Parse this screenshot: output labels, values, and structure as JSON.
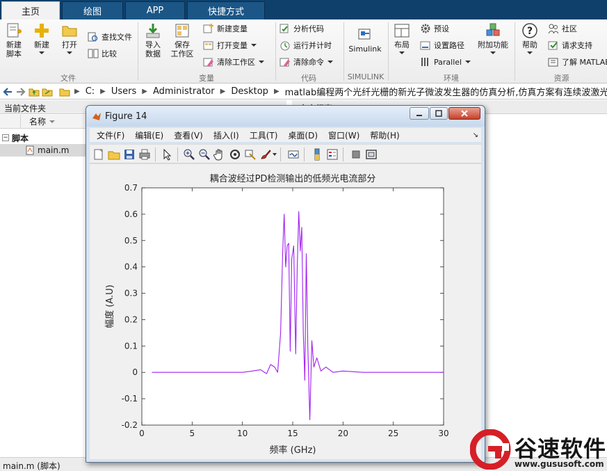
{
  "tabs": [
    {
      "label": "主页",
      "active": true
    },
    {
      "label": "绘图",
      "active": false
    },
    {
      "label": "APP",
      "active": false
    },
    {
      "label": "快捷方式",
      "active": false
    }
  ],
  "ribbon": {
    "file": {
      "new_script": "新建\n脚本",
      "new": "新建",
      "open": "打开",
      "find_files": "查找文件",
      "compare": "比较",
      "group": "文件"
    },
    "variable": {
      "import_data": "导入\n数据",
      "save_workspace": "保存\n工作区",
      "new_variable": "新建变量",
      "open_variable": "打开变量",
      "clear_workspace": "清除工作区",
      "group": "变量"
    },
    "code": {
      "analyze_code": "分析代码",
      "run_and_time": "运行并计时",
      "clear_commands": "清除命令",
      "group": "代码"
    },
    "simulink": {
      "label": "Simulink",
      "group": "SIMULINK"
    },
    "environment": {
      "layout": "布局",
      "preferences": "预设",
      "set_path": "设置路径",
      "parallel": "Parallel",
      "addons": "附加功能",
      "group": "环境"
    },
    "resources": {
      "help": "帮助",
      "community": "社区",
      "request_support": "请求支持",
      "learn_matlab": "了解 MATLAB",
      "group": "资源"
    }
  },
  "address": {
    "crumbs": [
      "C:",
      "Users",
      "Administrator",
      "Desktop",
      "matlab编程两个光纤光栅的新光子微波发生器的仿真分析,仿真方案有连续波激光器,分光器,"
    ]
  },
  "left_panel": {
    "title": "当前文件夹",
    "column_name": "名称",
    "folder": "脚本",
    "file": "main.m",
    "status": "main.m  (脚本)"
  },
  "command_window": {
    "title": "命令行窗口"
  },
  "figure": {
    "title": "Figure 14",
    "menus": [
      "文件(F)",
      "编辑(E)",
      "查看(V)",
      "插入(I)",
      "工具(T)",
      "桌面(D)",
      "窗口(W)",
      "帮助(H)"
    ]
  },
  "chart_data": {
    "type": "line",
    "title": "耦合波经过PD检测输出的低频光电流部分",
    "xlabel": "频率 (GHz)",
    "ylabel": "幅度 (A.U)",
    "xlim": [
      0,
      30
    ],
    "ylim": [
      -0.2,
      0.7
    ],
    "x_ticks": [
      0,
      5,
      10,
      15,
      20,
      25,
      30
    ],
    "y_ticks": [
      -0.2,
      -0.1,
      0,
      0.1,
      0.2,
      0.3,
      0.4,
      0.5,
      0.6,
      0.7
    ],
    "line_color": "#a020f0",
    "grid": false,
    "series": [
      {
        "x": [
          1,
          8,
          10,
          11,
          11.8,
          12.4,
          12.8,
          13.2,
          13.5,
          13.8,
          14.0,
          14.15,
          14.3,
          14.45,
          14.6,
          14.75,
          14.9,
          15.1,
          15.3,
          15.45,
          15.6,
          15.75,
          15.9,
          16.05,
          16.2,
          16.35,
          16.5,
          16.7,
          16.9,
          17.1,
          17.4,
          17.8,
          18.3,
          19.0,
          20,
          22,
          26,
          30
        ],
        "y": [
          0,
          0,
          0,
          0.005,
          0.01,
          -0.005,
          0.03,
          0.02,
          0.0,
          0.15,
          0.45,
          0.6,
          0.4,
          0.48,
          0.49,
          0.08,
          0.43,
          0.48,
          0.07,
          0.4,
          0.61,
          0.46,
          0.55,
          0.15,
          -0.03,
          0.45,
          0.1,
          -0.18,
          0.12,
          0.02,
          0.055,
          0.005,
          0.02,
          0.0,
          0.005,
          0,
          0,
          0
        ]
      }
    ]
  },
  "watermark": {
    "brand": "谷速软件",
    "url": "www.gususoft.com"
  }
}
